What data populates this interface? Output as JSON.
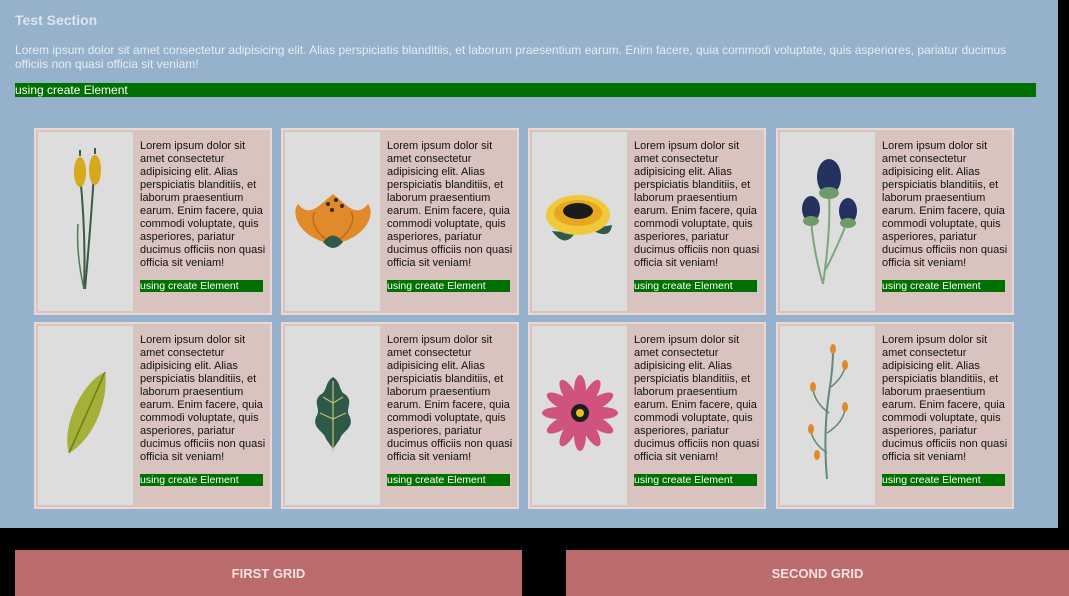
{
  "section": {
    "title": "Test Section",
    "description": "Lorem ipsum dolor sit amet consectetur adipisicing elit. Alias perspiciatis blanditiis, et laborum praesentium earum. Enim facere, quia commodi voluptate, quis asperiores, pariatur ducimus officiis non quasi officia sit veniam!",
    "bar_text": "using create Element"
  },
  "cards": [
    {
      "text": "Lorem ipsum dolor sit amet consectetur adipisicing elit. Alias perspiciatis blanditiis, et laborum praesentium earum. Enim facere, quia commodi voluptate, quis asperiores, pariatur ducimus officiis non quasi officia sit veniam!",
      "tag": "using create Element",
      "icon": "cattail-flower-icon"
    },
    {
      "text": "Lorem ipsum dolor sit amet consectetur adipisicing elit. Alias perspiciatis blanditiis, et laborum praesentium earum. Enim facere, quia commodi voluptate, quis asperiores, pariatur ducimus officiis non quasi officia sit veniam!",
      "tag": "using create Element",
      "icon": "orange-flower-icon"
    },
    {
      "text": "Lorem ipsum dolor sit amet consectetur adipisicing elit. Alias perspiciatis blanditiis, et laborum praesentium earum. Enim facere, quia commodi voluptate, quis asperiores, pariatur ducimus officiis non quasi officia sit veniam!",
      "tag": "using create Element",
      "icon": "yellow-flower-icon"
    },
    {
      "text": "Lorem ipsum dolor sit amet consectetur adipisicing elit. Alias perspiciatis blanditiis, et laborum praesentium earum. Enim facere, quia commodi voluptate, quis asperiores, pariatur ducimus officiis non quasi officia sit veniam!",
      "tag": "using create Element",
      "icon": "thistle-flower-icon"
    },
    {
      "text": "Lorem ipsum dolor sit amet consectetur adipisicing elit. Alias perspiciatis blanditiis, et laborum praesentium earum. Enim facere, quia commodi voluptate, quis asperiores, pariatur ducimus officiis non quasi officia sit veniam!",
      "tag": "using create Element",
      "icon": "leaf-icon"
    },
    {
      "text": "Lorem ipsum dolor sit amet consectetur adipisicing elit. Alias perspiciatis blanditiis, et laborum praesentium earum. Enim facere, quia commodi voluptate, quis asperiores, pariatur ducimus officiis non quasi officia sit veniam!",
      "tag": "using create Element",
      "icon": "oak-leaf-icon"
    },
    {
      "text": "Lorem ipsum dolor sit amet consectetur adipisicing elit. Alias perspiciatis blanditiis, et laborum praesentium earum. Enim facere, quia commodi voluptate, quis asperiores, pariatur ducimus officiis non quasi officia sit veniam!",
      "tag": "using create Element",
      "icon": "pink-daisy-icon"
    },
    {
      "text": "Lorem ipsum dolor sit amet consectetur adipisicing elit. Alias perspiciatis blanditiis, et laborum praesentium earum. Enim facere, quia commodi voluptate, quis asperiores, pariatur ducimus officiis non quasi officia sit veniam!",
      "tag": "using create Element",
      "icon": "berry-branch-icon"
    }
  ],
  "buttons": {
    "first": "FIRST GRID",
    "second": "SECOND GRID"
  },
  "colors": {
    "section_bg": "#95b1cb",
    "card_bg": "#d8c3bf",
    "green": "#007000",
    "button_bg": "#bb6b6b"
  }
}
